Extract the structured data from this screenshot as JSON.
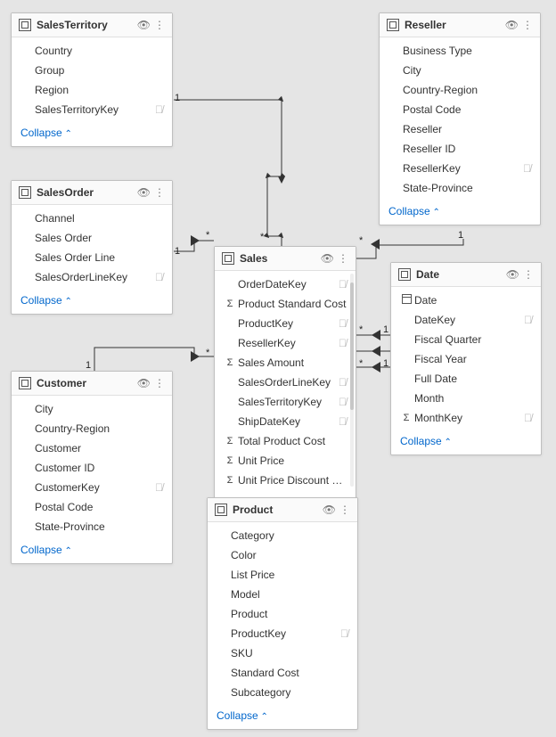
{
  "labels": {
    "collapse": "Collapse"
  },
  "tables": {
    "salesTerritory": {
      "name": "SalesTerritory",
      "fields": [
        {
          "name": "Country",
          "icon": "",
          "hidden": false
        },
        {
          "name": "Group",
          "icon": "",
          "hidden": false
        },
        {
          "name": "Region",
          "icon": "",
          "hidden": false
        },
        {
          "name": "SalesTerritoryKey",
          "icon": "",
          "hidden": true
        }
      ]
    },
    "salesOrder": {
      "name": "SalesOrder",
      "fields": [
        {
          "name": "Channel",
          "icon": "",
          "hidden": false
        },
        {
          "name": "Sales Order",
          "icon": "",
          "hidden": false
        },
        {
          "name": "Sales Order Line",
          "icon": "",
          "hidden": false
        },
        {
          "name": "SalesOrderLineKey",
          "icon": "",
          "hidden": true
        }
      ]
    },
    "customer": {
      "name": "Customer",
      "fields": [
        {
          "name": "City",
          "icon": "",
          "hidden": false
        },
        {
          "name": "Country-Region",
          "icon": "",
          "hidden": false
        },
        {
          "name": "Customer",
          "icon": "",
          "hidden": false
        },
        {
          "name": "Customer ID",
          "icon": "",
          "hidden": false
        },
        {
          "name": "CustomerKey",
          "icon": "",
          "hidden": true
        },
        {
          "name": "Postal Code",
          "icon": "",
          "hidden": false
        },
        {
          "name": "State-Province",
          "icon": "",
          "hidden": false
        }
      ]
    },
    "reseller": {
      "name": "Reseller",
      "fields": [
        {
          "name": "Business Type",
          "icon": "",
          "hidden": false
        },
        {
          "name": "City",
          "icon": "",
          "hidden": false
        },
        {
          "name": "Country-Region",
          "icon": "",
          "hidden": false
        },
        {
          "name": "Postal Code",
          "icon": "",
          "hidden": false
        },
        {
          "name": "Reseller",
          "icon": "",
          "hidden": false
        },
        {
          "name": "Reseller ID",
          "icon": "",
          "hidden": false
        },
        {
          "name": "ResellerKey",
          "icon": "",
          "hidden": true
        },
        {
          "name": "State-Province",
          "icon": "",
          "hidden": false
        }
      ]
    },
    "sales": {
      "name": "Sales",
      "fields": [
        {
          "name": "OrderDateKey",
          "icon": "",
          "hidden": true
        },
        {
          "name": "Product Standard Cost",
          "icon": "Σ",
          "hidden": false
        },
        {
          "name": "ProductKey",
          "icon": "",
          "hidden": true
        },
        {
          "name": "ResellerKey",
          "icon": "",
          "hidden": true
        },
        {
          "name": "Sales Amount",
          "icon": "Σ",
          "hidden": false
        },
        {
          "name": "SalesOrderLineKey",
          "icon": "",
          "hidden": true
        },
        {
          "name": "SalesTerritoryKey",
          "icon": "",
          "hidden": true
        },
        {
          "name": "ShipDateKey",
          "icon": "",
          "hidden": true
        },
        {
          "name": "Total Product Cost",
          "icon": "Σ",
          "hidden": false
        },
        {
          "name": "Unit Price",
          "icon": "Σ",
          "hidden": false
        },
        {
          "name": "Unit Price Discount Pct",
          "icon": "Σ",
          "hidden": false
        }
      ]
    },
    "date": {
      "name": "Date",
      "fields": [
        {
          "name": "Date",
          "icon": "date",
          "hidden": false
        },
        {
          "name": "DateKey",
          "icon": "",
          "hidden": true
        },
        {
          "name": "Fiscal Quarter",
          "icon": "",
          "hidden": false
        },
        {
          "name": "Fiscal Year",
          "icon": "",
          "hidden": false
        },
        {
          "name": "Full Date",
          "icon": "",
          "hidden": false
        },
        {
          "name": "Month",
          "icon": "",
          "hidden": false
        },
        {
          "name": "MonthKey",
          "icon": "Σ",
          "hidden": true
        }
      ]
    },
    "product": {
      "name": "Product",
      "fields": [
        {
          "name": "Category",
          "icon": "",
          "hidden": false
        },
        {
          "name": "Color",
          "icon": "",
          "hidden": false
        },
        {
          "name": "List Price",
          "icon": "",
          "hidden": false
        },
        {
          "name": "Model",
          "icon": "",
          "hidden": false
        },
        {
          "name": "Product",
          "icon": "",
          "hidden": false
        },
        {
          "name": "ProductKey",
          "icon": "",
          "hidden": true
        },
        {
          "name": "SKU",
          "icon": "",
          "hidden": false
        },
        {
          "name": "Standard Cost",
          "icon": "",
          "hidden": false
        },
        {
          "name": "Subcategory",
          "icon": "",
          "hidden": false
        }
      ]
    }
  },
  "relationships": [
    {
      "from": "SalesTerritory",
      "to": "Sales",
      "fromCard": "1",
      "toCard": "*"
    },
    {
      "from": "SalesOrder",
      "to": "Sales",
      "fromCard": "1",
      "toCard": "*"
    },
    {
      "from": "Customer",
      "to": "Sales",
      "fromCard": "1",
      "toCard": "*"
    },
    {
      "from": "Reseller",
      "to": "Sales",
      "fromCard": "1",
      "toCard": "*"
    },
    {
      "from": "Date",
      "to": "Sales",
      "fromCard": "1",
      "toCard": "*",
      "multi": 3
    },
    {
      "from": "Product",
      "to": "Sales",
      "fromCard": "1",
      "toCard": "*"
    }
  ]
}
